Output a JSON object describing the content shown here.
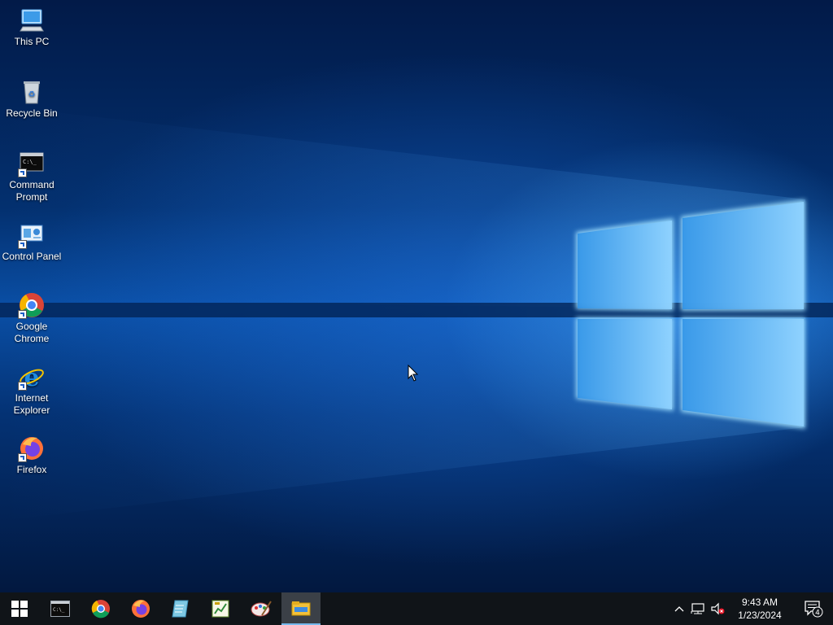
{
  "desktop": {
    "icons": [
      {
        "label": "This PC",
        "icon": "computer-icon"
      },
      {
        "label": "Recycle Bin",
        "icon": "recycle-bin-icon"
      },
      {
        "label": "Command Prompt",
        "icon": "command-prompt-icon"
      },
      {
        "label": "Control Panel",
        "icon": "control-panel-icon"
      },
      {
        "label": "Google Chrome",
        "icon": "chrome-icon"
      },
      {
        "label": "Internet Explorer",
        "icon": "internet-explorer-icon"
      },
      {
        "label": "Firefox",
        "icon": "firefox-icon"
      }
    ]
  },
  "taskbar": {
    "start_icon": "windows-logo-icon",
    "pinned": [
      {
        "icon": "command-prompt-icon"
      },
      {
        "icon": "chrome-icon"
      },
      {
        "icon": "firefox-icon"
      },
      {
        "icon": "notepad-icon"
      },
      {
        "icon": "spreadsheet-icon"
      },
      {
        "icon": "paint-icon"
      },
      {
        "icon": "file-explorer-icon",
        "active": true
      }
    ],
    "tray": {
      "chevron_icon": "chevron-up-icon",
      "network_icon": "network-icon",
      "volume_icon": "volume-muted-icon",
      "time": "9:43 AM",
      "date": "1/23/2024",
      "notification_count": "4"
    }
  },
  "colors": {
    "taskbar": "#101418",
    "active_underline": "#76b9ed",
    "accent": "#1d5fc5"
  }
}
